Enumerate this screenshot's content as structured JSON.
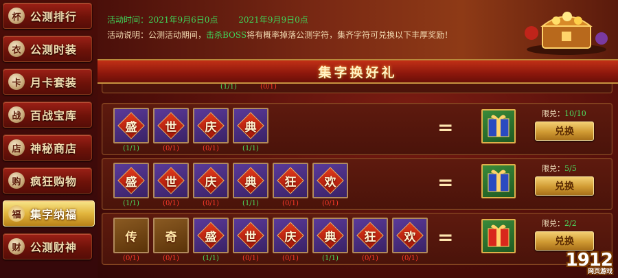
{
  "sidebar": {
    "items": [
      {
        "icon": "trophy-icon",
        "glyph": "杯",
        "label": "公测排行",
        "active": false
      },
      {
        "icon": "costume-icon",
        "glyph": "衣",
        "label": "公测时装",
        "active": false
      },
      {
        "icon": "card-icon",
        "glyph": "卡",
        "label": "月卡套装",
        "active": false
      },
      {
        "icon": "crossed-swords-icon",
        "glyph": "战",
        "label": "百战宝库",
        "active": false
      },
      {
        "icon": "shop-icon",
        "glyph": "店",
        "label": "神秘商店",
        "active": false
      },
      {
        "icon": "cart-icon",
        "glyph": "购",
        "label": "疯狂购物",
        "active": false
      },
      {
        "icon": "blessing-icon",
        "glyph": "福",
        "label": "集字纳福",
        "active": true
      },
      {
        "icon": "money-icon",
        "glyph": "财",
        "label": "公测财神",
        "active": false
      }
    ]
  },
  "info": {
    "time_start": "活动时间：2021年9月6日0点",
    "time_end": "2021年9月9日0点",
    "desc_prefix": "活动说明：公测活动期间，",
    "desc_keyword": "击杀BOSS",
    "desc_suffix": "将有概率掉落公测字符，集齐字符可兑换以下丰厚奖励！"
  },
  "title": "集字换好礼",
  "partial_row": {
    "counts": [
      {
        "text": "(1/1)",
        "ok": true
      },
      {
        "text": "(0/1)",
        "ok": false
      }
    ]
  },
  "rows": [
    {
      "tiles": [
        {
          "char": "盛",
          "count": "(1/1)",
          "ok": true
        },
        {
          "char": "世",
          "count": "(0/1)",
          "ok": false
        },
        {
          "char": "庆",
          "count": "(0/1)",
          "ok": false
        },
        {
          "char": "典",
          "count": "(1/1)",
          "ok": true
        }
      ],
      "gift_color": "blue",
      "limit_label": "限兑：",
      "limit_value": "10/10",
      "button": "兑换"
    },
    {
      "tiles": [
        {
          "char": "盛",
          "count": "(1/1)",
          "ok": true
        },
        {
          "char": "世",
          "count": "(0/1)",
          "ok": false
        },
        {
          "char": "庆",
          "count": "(0/1)",
          "ok": false
        },
        {
          "char": "典",
          "count": "(1/1)",
          "ok": true
        },
        {
          "char": "狂",
          "count": "(0/1)",
          "ok": false
        },
        {
          "char": "欢",
          "count": "(0/1)",
          "ok": false
        }
      ],
      "gift_color": "blue",
      "limit_label": "限兑：",
      "limit_value": "5/5",
      "button": "兑换"
    },
    {
      "tiles": [
        {
          "char": "传",
          "count": "(0/1)",
          "ok": false,
          "gold": true
        },
        {
          "char": "奇",
          "count": "(0/1)",
          "ok": false,
          "gold": true
        },
        {
          "char": "盛",
          "count": "(1/1)",
          "ok": true
        },
        {
          "char": "世",
          "count": "(0/1)",
          "ok": false
        },
        {
          "char": "庆",
          "count": "(0/1)",
          "ok": false
        },
        {
          "char": "典",
          "count": "(1/1)",
          "ok": true
        },
        {
          "char": "狂",
          "count": "(0/1)",
          "ok": false
        },
        {
          "char": "欢",
          "count": "(0/1)",
          "ok": false
        }
      ],
      "gift_color": "red",
      "limit_label": "限兑：",
      "limit_value": "2/2",
      "button": "兑换"
    }
  ],
  "equals_sign": "=",
  "watermark": {
    "main": "1912",
    "sub": "网页游戏"
  },
  "colors": {
    "ok": "#4be060",
    "missing": "#ff3a2a",
    "accent_gold": "#e2b53d"
  }
}
